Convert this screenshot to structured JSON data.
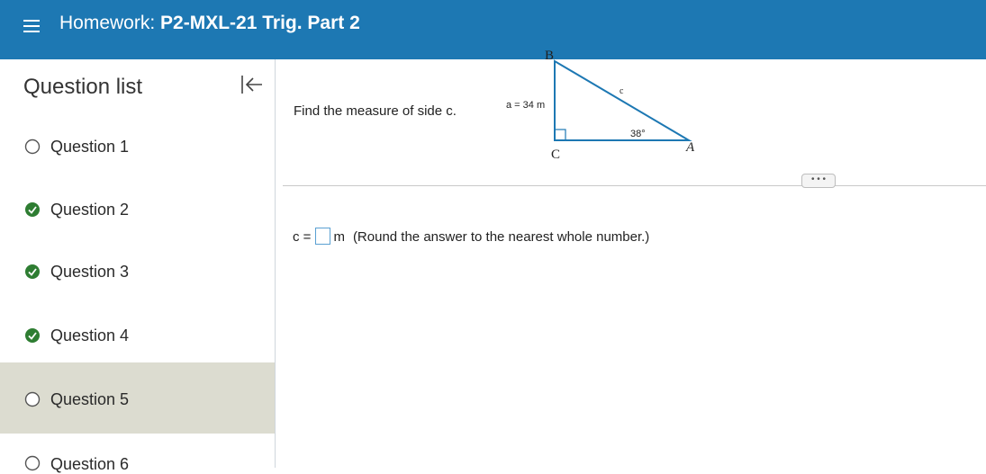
{
  "header": {
    "prefix": "Homework:",
    "name": "P2-MXL-21 Trig. Part 2"
  },
  "sidebar": {
    "title": "Question list",
    "questions": [
      {
        "label": "Question 1",
        "status": "unanswered"
      },
      {
        "label": "Question 2",
        "status": "complete"
      },
      {
        "label": "Question 3",
        "status": "complete"
      },
      {
        "label": "Question 4",
        "status": "complete"
      },
      {
        "label": "Question 5",
        "status": "unanswered"
      },
      {
        "label": "Question 6",
        "status": "unanswered"
      }
    ]
  },
  "question": {
    "prompt": "Find the measure of side c.",
    "figure": {
      "vertex_b": "B",
      "vertex_c": "C",
      "vertex_a": "A",
      "side_a": "a = 34 m",
      "side_c": "c",
      "angle": "38°"
    },
    "answer": {
      "prefix": "c =",
      "value": "",
      "unit": "m",
      "hint": "(Round the answer to the nearest whole number.)"
    }
  },
  "more_label": "• • •",
  "colors": {
    "header": "#1d78b3",
    "complete": "#2e7d32",
    "active_row": "#dcdcd0"
  }
}
